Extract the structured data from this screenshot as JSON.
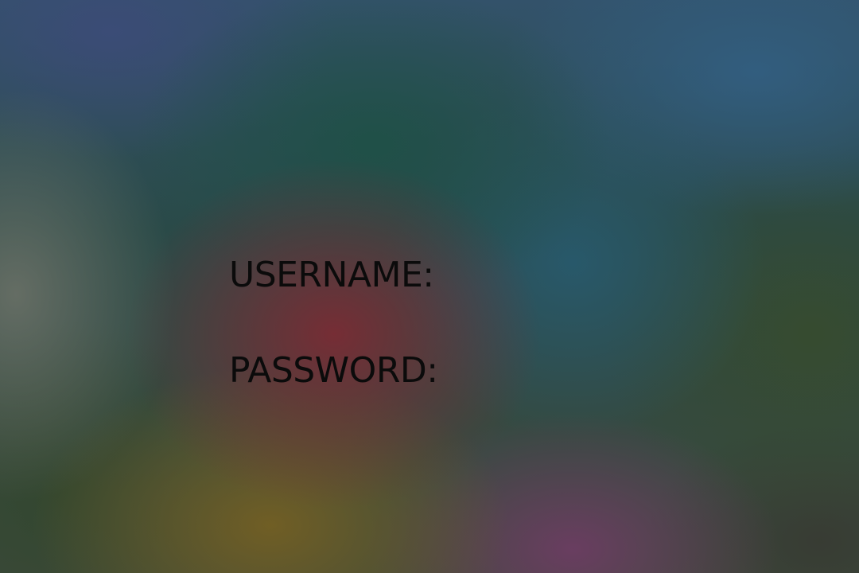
{
  "login": {
    "username_label": "USERNAME:",
    "username_value": "",
    "password_label": "PASSWORD:",
    "password_value": ""
  }
}
